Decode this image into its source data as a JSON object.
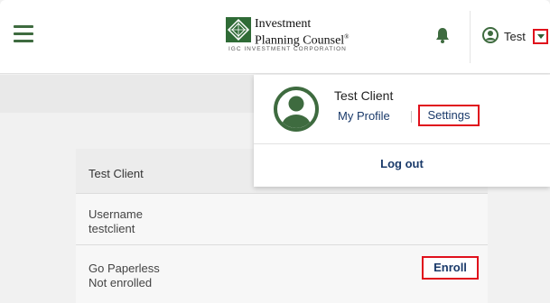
{
  "header": {
    "logo": {
      "line1": "Investment",
      "line2": "Planning Counsel",
      "mark": "®",
      "tagline": "IGC INVESTMENT CORPORATION"
    },
    "user_short_name": "Test",
    "icons": {
      "menu": "hamburger-icon",
      "notifications": "bell-icon",
      "user": "user-circle-icon",
      "dropdown": "caret-down-icon"
    }
  },
  "dropdown": {
    "name": "Test Client",
    "my_profile": "My Profile",
    "settings": "Settings",
    "logout": "Log out"
  },
  "card": {
    "title": "Test Client",
    "username_label": "Username",
    "username_value": "testclient",
    "paperless_label": "Go Paperless",
    "paperless_value": "Not enrolled",
    "enroll": "Enroll"
  },
  "colors": {
    "brand_green": "#3e6b3f",
    "link_blue": "#1a3a6a",
    "highlight_red": "#e0101c"
  }
}
